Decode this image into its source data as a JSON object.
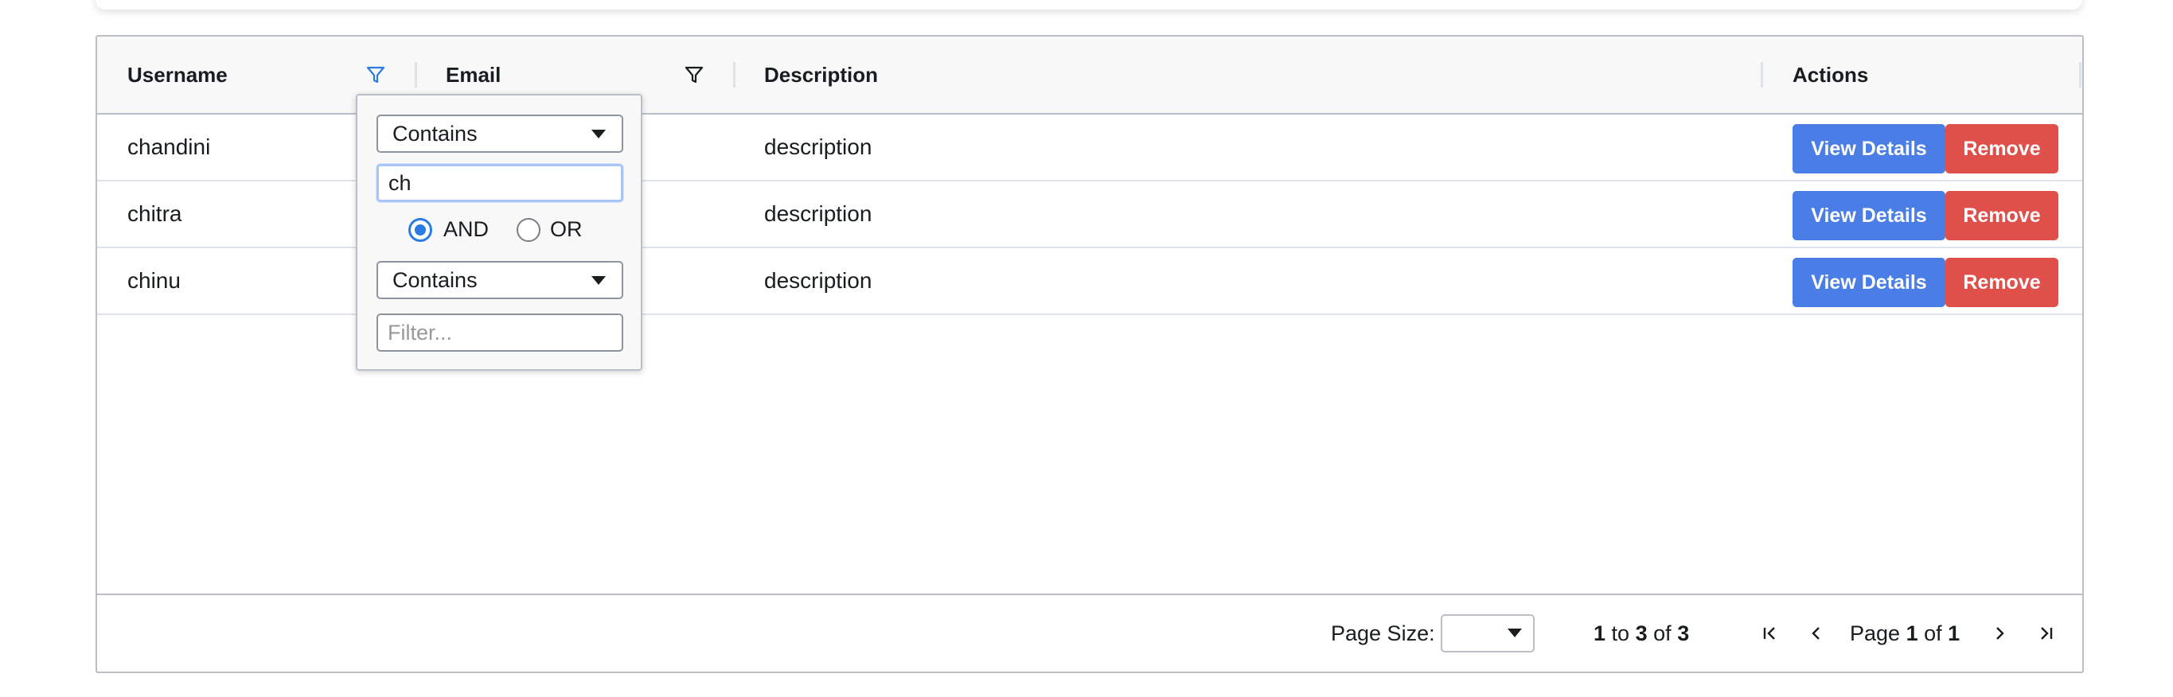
{
  "columns": {
    "username": "Username",
    "email": "Email",
    "description": "Description",
    "actions": "Actions"
  },
  "rows": [
    {
      "username": "chandini",
      "description": "description",
      "view_label": "View Details",
      "remove_label": "Remove"
    },
    {
      "username": "chitra",
      "description": "description",
      "view_label": "View Details",
      "remove_label": "Remove"
    },
    {
      "username": "chinu",
      "description": "description",
      "view_label": "View Details",
      "remove_label": "Remove"
    }
  ],
  "filter_popup": {
    "condition1_type": "Contains",
    "condition1_value": "ch",
    "join_and": "AND",
    "join_or": "OR",
    "join_selected": "AND",
    "condition2_type": "Contains",
    "condition2_placeholder": "Filter..."
  },
  "footer": {
    "page_size_label": "Page Size:",
    "row_from": "1",
    "to_word": "to",
    "row_to": "3",
    "of_word": "of",
    "row_total": "3",
    "page_word": "Page",
    "page_current": "1",
    "page_of_word": "of",
    "page_total": "1"
  },
  "colors": {
    "accent": "#2b7be4",
    "view_button": "#4a7ee6",
    "remove_button": "#e0504b",
    "border": "#babfc7"
  },
  "icons": [
    "filter-active-icon",
    "filter-icon",
    "first-page-icon",
    "previous-page-icon",
    "next-page-icon",
    "last-page-icon",
    "dropdown-caret-icon"
  ]
}
